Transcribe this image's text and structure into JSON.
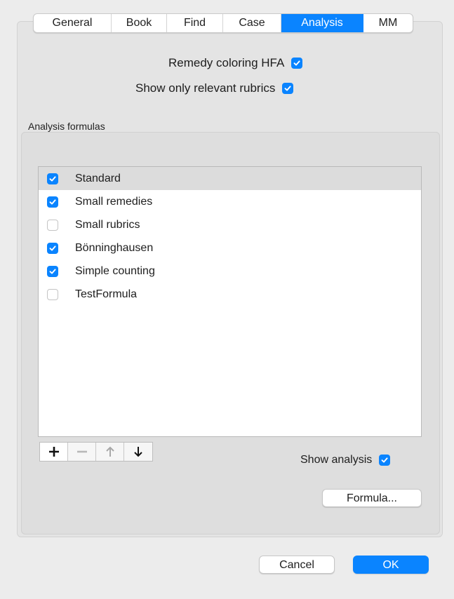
{
  "tabs": [
    {
      "label": "General",
      "selected": false
    },
    {
      "label": "Book",
      "selected": false
    },
    {
      "label": "Find",
      "selected": false
    },
    {
      "label": "Case",
      "selected": false
    },
    {
      "label": "Analysis",
      "selected": true
    },
    {
      "label": "MM",
      "selected": false
    }
  ],
  "options": {
    "remedy_coloring": {
      "label": "Remedy coloring HFA",
      "checked": true
    },
    "show_relevant": {
      "label": "Show only relevant rubrics",
      "checked": true
    }
  },
  "formulas": {
    "section_label": "Analysis formulas",
    "items": [
      {
        "label": "Standard",
        "checked": true,
        "selected": true
      },
      {
        "label": "Small remedies",
        "checked": true,
        "selected": false
      },
      {
        "label": "Small rubrics",
        "checked": false,
        "selected": false
      },
      {
        "label": "Bönninghausen",
        "checked": true,
        "selected": false
      },
      {
        "label": "Simple counting",
        "checked": true,
        "selected": false
      },
      {
        "label": "TestFormula",
        "checked": false,
        "selected": false
      }
    ],
    "toolbar": {
      "add_icon": "plus-icon",
      "remove_icon": "minus-icon",
      "up_icon": "arrow-up-icon",
      "down_icon": "arrow-down-icon"
    },
    "show_analysis": {
      "label": "Show analysis",
      "checked": true
    },
    "formula_button": "Formula..."
  },
  "footer": {
    "cancel_label": "Cancel",
    "ok_label": "OK"
  },
  "colors": {
    "accent": "#0a84ff",
    "window_bg": "#ececec"
  }
}
